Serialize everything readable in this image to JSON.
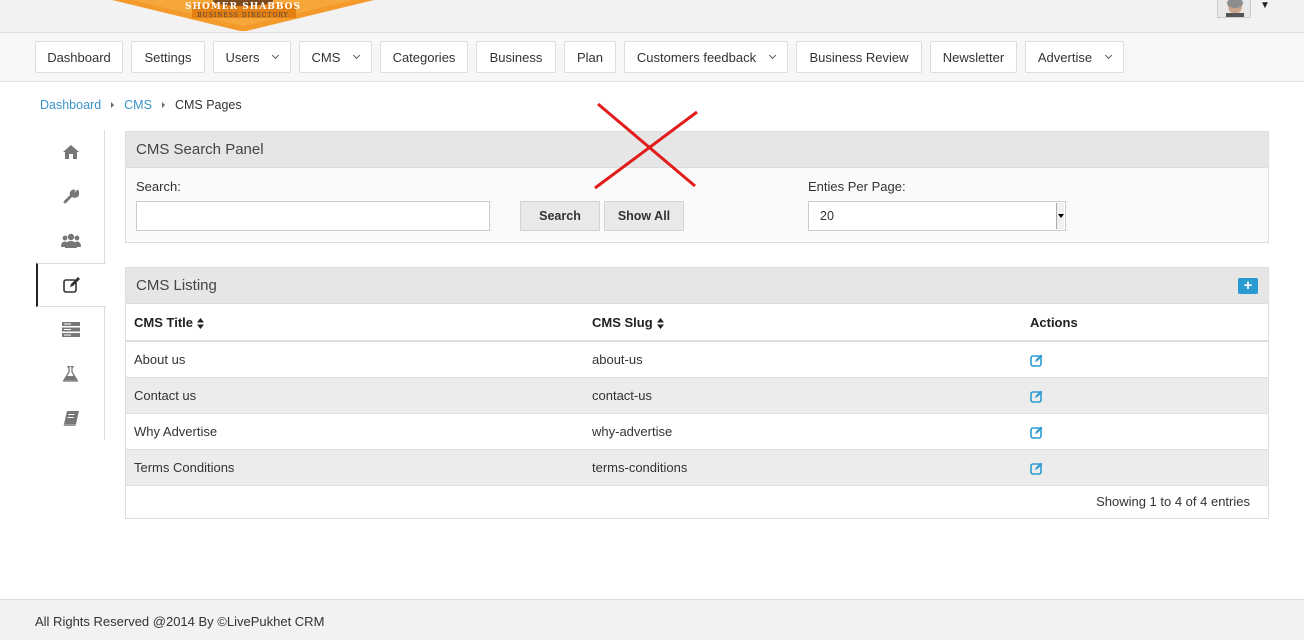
{
  "header": {
    "logo_line1": "SHOMER SHABBOS",
    "logo_line2": "BUSINESS DIRECTORY",
    "avatar_icon": "user-avatar",
    "menu_icon": "caret-down-icon"
  },
  "nav": {
    "items": [
      {
        "label": "Dashboard",
        "dropdown": false
      },
      {
        "label": "Settings",
        "dropdown": false
      },
      {
        "label": "Users",
        "dropdown": true
      },
      {
        "label": "CMS",
        "dropdown": true
      },
      {
        "label": "Categories",
        "dropdown": false
      },
      {
        "label": "Business",
        "dropdown": false
      },
      {
        "label": "Plan",
        "dropdown": false
      },
      {
        "label": "Customers feedback",
        "dropdown": true
      },
      {
        "label": "Business Review",
        "dropdown": false
      },
      {
        "label": "Newsletter",
        "dropdown": false
      },
      {
        "label": "Advertise",
        "dropdown": true
      }
    ]
  },
  "breadcrumb": {
    "items": [
      "Dashboard",
      "CMS"
    ],
    "current": "CMS Pages"
  },
  "sidebar": {
    "icons": [
      "home-icon",
      "wrench-icon",
      "users-icon",
      "edit-icon",
      "server-icon",
      "flask-icon",
      "book-icon"
    ],
    "active": "edit-icon"
  },
  "search_panel": {
    "title": "CMS Search Panel",
    "search_label": "Search:",
    "search_value": "",
    "search_button": "Search",
    "show_all_button": "Show All",
    "per_page_label": "Enties Per Page:",
    "per_page_value": "20"
  },
  "listing": {
    "title": "CMS Listing",
    "add_icon": "plus-icon",
    "columns": [
      "CMS Title",
      "CMS Slug",
      "Actions"
    ],
    "rows": [
      {
        "title": "About us",
        "slug": "about-us"
      },
      {
        "title": "Contact us",
        "slug": "contact-us"
      },
      {
        "title": "Why Advertise",
        "slug": "why-advertise"
      },
      {
        "title": "Terms Conditions",
        "slug": "terms-conditions"
      }
    ],
    "showing": "Showing 1 to 4 of 4 entries"
  },
  "footer": {
    "text": "All Rights Reserved @2014 By ©LivePukhet CRM"
  },
  "colors": {
    "link": "#3a94c9",
    "accent": "#2a9bd1",
    "logo_orange": "#f39a2b",
    "annotation_red": "#e21b1b"
  }
}
